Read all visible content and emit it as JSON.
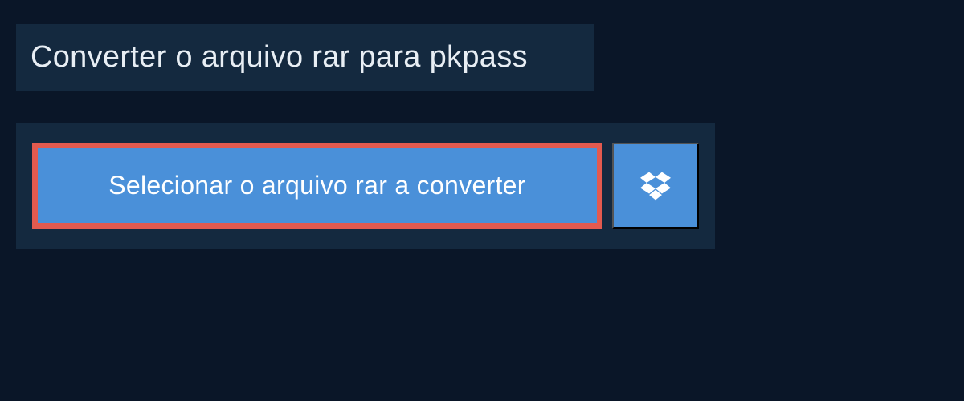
{
  "header": {
    "title": "Converter o arquivo rar para pkpass"
  },
  "upload": {
    "select_label": "Selecionar o arquivo rar a converter",
    "dropbox_icon_name": "dropbox"
  },
  "colors": {
    "background": "#0a1628",
    "panel": "#14293f",
    "primary_button": "#4a90d9",
    "highlight_border": "#e35a4f",
    "text_light": "#e8eef4"
  }
}
